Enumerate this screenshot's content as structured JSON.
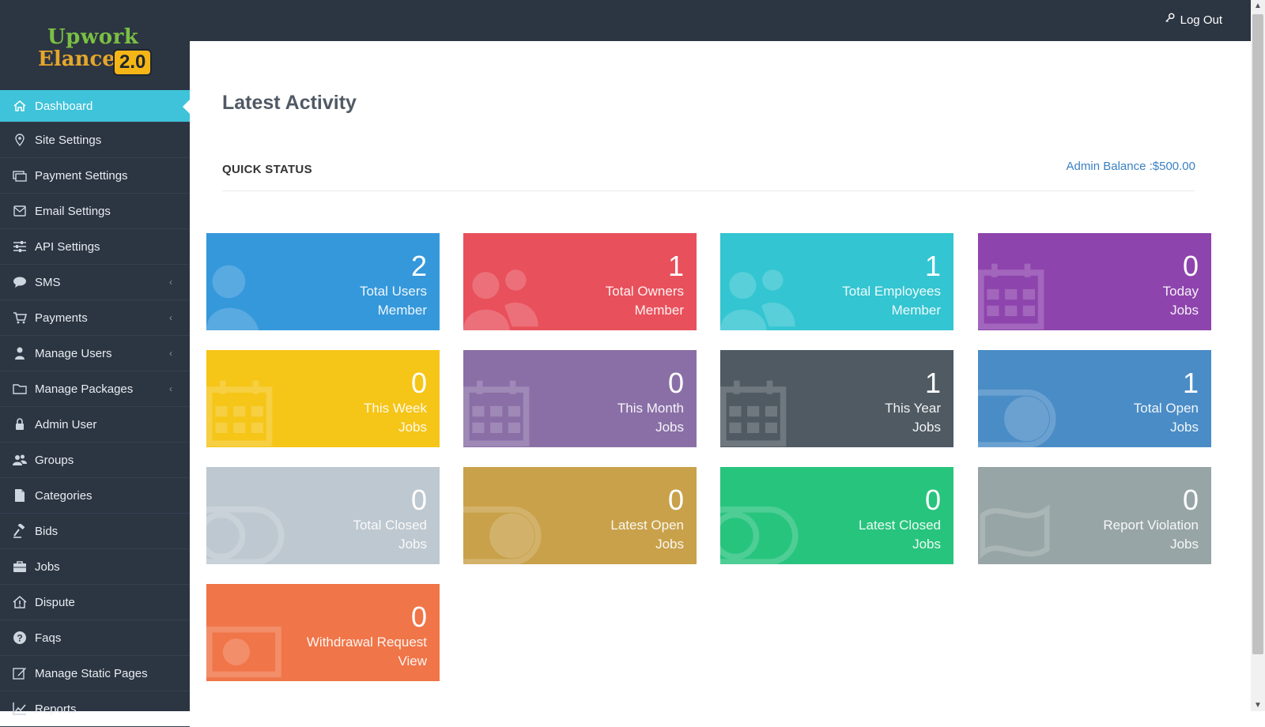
{
  "app": {
    "logo_line1": "Upwork",
    "logo_line2": "Elance",
    "logo_version": "2.0"
  },
  "header": {
    "logout_label": "Log Out"
  },
  "sidebar": {
    "items": [
      {
        "label": "Dashboard",
        "icon": "home-icon",
        "active": true
      },
      {
        "label": "Site Settings",
        "icon": "map-pin-icon"
      },
      {
        "label": "Payment Settings",
        "icon": "payment-card-icon"
      },
      {
        "label": "Email Settings",
        "icon": "envelope-icon"
      },
      {
        "label": "API Settings",
        "icon": "sliders-icon"
      },
      {
        "label": "SMS",
        "icon": "chat-bubble-icon",
        "expandable": true
      },
      {
        "label": "Payments",
        "icon": "cart-icon",
        "expandable": true
      },
      {
        "label": "Manage Users",
        "icon": "user-icon",
        "expandable": true
      },
      {
        "label": "Manage Packages",
        "icon": "folder-icon",
        "expandable": true
      },
      {
        "label": "Admin User",
        "icon": "lock-icon"
      },
      {
        "label": "Groups",
        "icon": "users-icon"
      },
      {
        "label": "Categories",
        "icon": "file-icon"
      },
      {
        "label": "Bids",
        "icon": "gavel-icon"
      },
      {
        "label": "Jobs",
        "icon": "briefcase-icon"
      },
      {
        "label": "Dispute",
        "icon": "house-alert-icon"
      },
      {
        "label": "Faqs",
        "icon": "question-circle-icon"
      },
      {
        "label": "Manage Static Pages",
        "icon": "edit-icon"
      },
      {
        "label": "Reports",
        "icon": "line-chart-icon"
      }
    ]
  },
  "main": {
    "title": "Latest Activity",
    "section_title": "QUICK STATUS",
    "balance": "Admin Balance :$500.00",
    "tiles": [
      {
        "value": "2",
        "line1": "Total Users",
        "line2": "Member",
        "color": "#3498db",
        "icon": "user-icon"
      },
      {
        "value": "1",
        "line1": "Total Owners",
        "line2": "Member",
        "color": "#e8505b",
        "icon": "users-icon"
      },
      {
        "value": "1",
        "line1": "Total Employees",
        "line2": "Member",
        "color": "#33c5d1",
        "icon": "users-icon"
      },
      {
        "value": "0",
        "line1": "Today",
        "line2": "Jobs",
        "color": "#8e44ad",
        "icon": "calendar-icon"
      },
      {
        "value": "0",
        "line1": "This Week",
        "line2": "Jobs",
        "color": "#f5c518",
        "icon": "calendar-icon"
      },
      {
        "value": "0",
        "line1": "This Month",
        "line2": "Jobs",
        "color": "#8a6fa7",
        "icon": "calendar-icon"
      },
      {
        "value": "1",
        "line1": "This Year",
        "line2": "Jobs",
        "color": "#4f5a63",
        "icon": "calendar-icon"
      },
      {
        "value": "1",
        "line1": "Total Open",
        "line2": "Jobs",
        "color": "#4a8cc6",
        "icon": "toggle-on-icon"
      },
      {
        "value": "0",
        "line1": "Total Closed",
        "line2": "Jobs",
        "color": "#bec8d0",
        "icon": "toggle-off-icon"
      },
      {
        "value": "0",
        "line1": "Latest Open",
        "line2": "Jobs",
        "color": "#c8a14a",
        "icon": "toggle-on-icon"
      },
      {
        "value": "0",
        "line1": "Latest Closed",
        "line2": "Jobs",
        "color": "#27c47d",
        "icon": "toggle-off-icon"
      },
      {
        "value": "0",
        "line1": "Report Violation",
        "line2": "Jobs",
        "color": "#98a5a6",
        "icon": "flag-icon"
      },
      {
        "value": "0",
        "line1": "Withdrawal Request",
        "line2": "View",
        "color": "#f07548",
        "icon": "money-icon"
      }
    ]
  }
}
